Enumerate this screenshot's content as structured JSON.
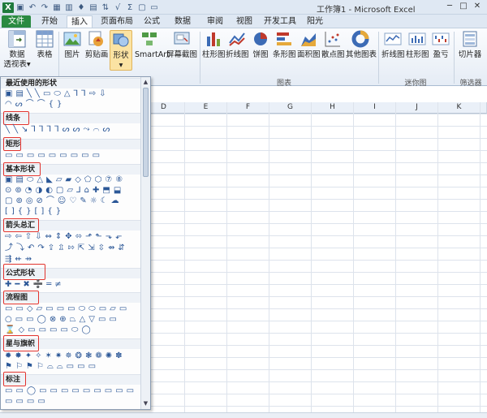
{
  "titlebar": {
    "title": "工作簿1 - Microsoft Excel",
    "qat_icons": [
      "excel-logo-icon",
      "save-icon",
      "undo-icon",
      "redo-icon",
      "table-icon",
      "group-icon",
      "paint-icon",
      "insert-table-icon",
      "sort-icon",
      "filter-icon",
      "sum-icon",
      "new-icon",
      "border-icon"
    ],
    "qat_glyphs": [
      "X",
      "▣",
      "↶",
      "↷",
      "▦",
      "▥",
      "♦",
      "▤",
      "⇅",
      "√",
      "Σ",
      "▢",
      "▭"
    ],
    "window_glyphs": [
      "─",
      "□",
      "✕"
    ]
  },
  "tabs": [
    {
      "label": "文件"
    },
    {
      "label": "开始"
    },
    {
      "label": "插入"
    },
    {
      "label": "页面布局"
    },
    {
      "label": "公式"
    },
    {
      "label": "数据"
    },
    {
      "label": "审阅"
    },
    {
      "label": "视图"
    },
    {
      "label": "开发工具"
    },
    {
      "label": "阳光"
    }
  ],
  "ribbon": {
    "pivot": "数据\n透视表",
    "pivot_line1": "数据",
    "pivot_line2": "透视表",
    "pivot_arrow": "▾",
    "table": "表格",
    "picture": "图片",
    "clipart": "剪贴画",
    "shapes": "形状",
    "shapes_arrow": "▾",
    "smartart": "SmartArt",
    "screenshot": "屏幕截图",
    "column_chart": "柱形图",
    "line_chart": "折线图",
    "pie_chart": "饼图",
    "bar_chart": "条形图",
    "area_chart": "面积图",
    "scatter_chart": "散点图",
    "other_chart": "其他图表",
    "group_charts": "图表",
    "spark_line": "折线图",
    "spark_column": "柱形图",
    "spark_winloss": "盈亏",
    "group_sparklines": "迷你图",
    "slicer": "切片器",
    "group_filter": "筛选器"
  },
  "sheet": {
    "columns": [
      "D",
      "E",
      "F",
      "G",
      "H",
      "I",
      "J",
      "K"
    ]
  },
  "shapes_panel": {
    "sections": [
      {
        "title": "最近使用的形状",
        "rows": [
          "▣▤╲╲▭⬭△⅂⅂⇨⇩",
          "◠ᔕ⌒⌒{}"
        ]
      },
      {
        "title": "线条",
        "rows": [
          "╲╲↘⅂⅂⅂⅂ᔕᔕ⤳⌒ᔕ"
        ]
      },
      {
        "title": "矩形",
        "rows": [
          "▭▭▭▭▭▭▭▭▭"
        ]
      },
      {
        "title": "基本形状",
        "rows": [
          "▣▤⬭△◣▱▰◇⬠⬡⑦⑧",
          "⊙⊚◔◑◐▢▱⅃⌂✚⬒⬓",
          "▢⊚◎⊘⌒☺♡✎☼☾☁",
          "[]{}[]{}"
        ]
      },
      {
        "title": "箭头总汇",
        "rows": [
          "⇨⇦⇧⇩⇔⇕✥⬄⬏⬑⬎⬐",
          "⤴⤵↶↷⇪⇫⇰⇱⇲⇳⇴⇵",
          "⇶⇷⇸"
        ]
      },
      {
        "title": "公式形状",
        "rows": [
          "✚━✖➗═≠"
        ]
      },
      {
        "title": "流程图",
        "rows": [
          "▭▭◇▱▭▭▭⬭⬭▭▱▭",
          "○▭▭◯⊗⊕⏢△▽▭▭",
          "⌛◇▭▭▭▭⬭◯"
        ]
      },
      {
        "title": "星与旗帜",
        "rows": [
          "✹✸✦✧✶✷✵❂❃❁✺✽",
          "⚑⚐⚑⚐⌓⌓▭▭▭"
        ]
      },
      {
        "title": "标注",
        "rows": [
          "▭▭◯▭▭▭▭▭▭▭▭▭",
          "▭▭▭▭"
        ]
      }
    ]
  }
}
